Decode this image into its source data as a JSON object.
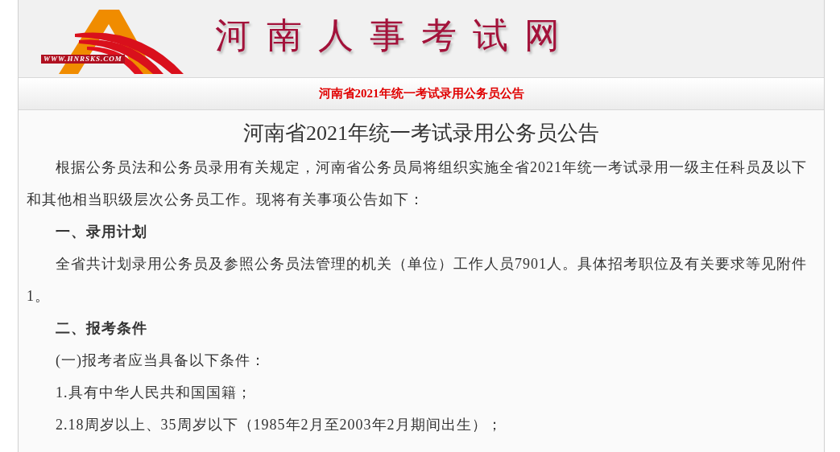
{
  "header": {
    "logo_url": "WWW.HNRSKS.COM",
    "site_name": "河南人事考试网"
  },
  "title_bar": {
    "text": "河南省2021年统一考试录用公务员公告"
  },
  "article": {
    "title": "河南省2021年统一考试录用公务员公告",
    "paragraphs": [
      {
        "kind": "para",
        "text": "根据公务员法和公务员录用有关规定，河南省公务员局将组织实施全省2021年统一考试录用一级主任科员及以下和其他相当职级层次公务员工作。现将有关事项公告如下："
      },
      {
        "kind": "heading",
        "text": "一、录用计划"
      },
      {
        "kind": "para",
        "text": "全省共计划录用公务员及参照公务员法管理的机关（单位）工作人员7901人。具体招考职位及有关要求等见附件1。"
      },
      {
        "kind": "heading",
        "text": "二、报考条件"
      },
      {
        "kind": "para",
        "text": "(一)报考者应当具备以下条件："
      },
      {
        "kind": "para",
        "text": "1.具有中华人民共和国国籍；"
      },
      {
        "kind": "para",
        "text": "2.18周岁以上、35周岁以下（1985年2月至2003年2月期间出生）；"
      }
    ]
  }
}
